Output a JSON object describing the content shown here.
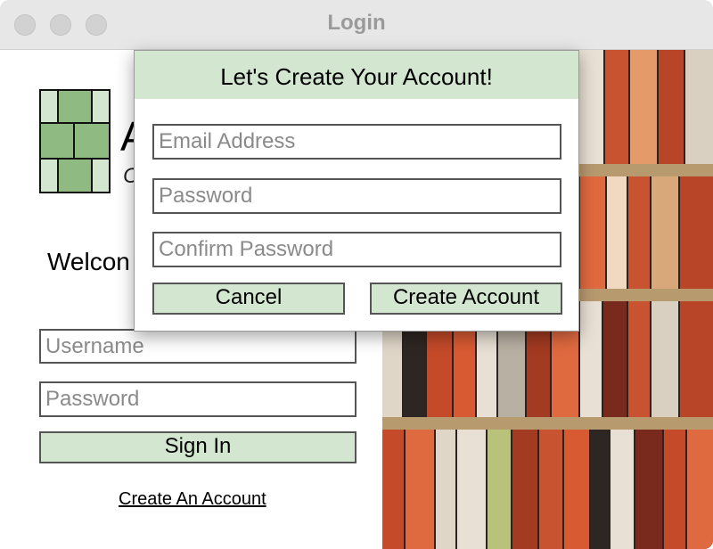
{
  "window": {
    "title": "Login"
  },
  "login": {
    "brand_initial": "A",
    "brand_sub": "C",
    "welcome_text": "Welcon",
    "username_placeholder": "Username",
    "password_placeholder": "Password",
    "sign_in_label": "Sign In",
    "create_account_link": "Create An Account"
  },
  "dialog": {
    "title": "Let's Create Your Account!",
    "email_placeholder": "Email Address",
    "password_placeholder": "Password",
    "confirm_password_placeholder": "Confirm Password",
    "cancel_label": "Cancel",
    "create_label": "Create Account"
  },
  "colors": {
    "accent_green_light": "#d3e7d0",
    "accent_green": "#8fba82",
    "titlebar": "#e8e7e8"
  }
}
